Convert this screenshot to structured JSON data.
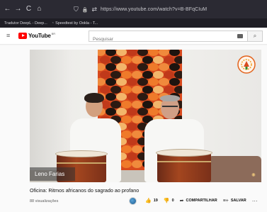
{
  "browser": {
    "nav": {
      "back_icon": "←",
      "forward_icon": "→",
      "reload_icon": "C",
      "home_icon": "⌂"
    },
    "url_bar": {
      "shield_icon": "⛉",
      "lock_icon": "🔒",
      "permissions_icon": "⇄",
      "url": "https://www.youtube.com/watch?v=B-BFqCIuM"
    },
    "bookmarks": [
      {
        "label": "Tradutor DeepL - Deep..."
      },
      {
        "label": "Speedtest by Ookla - T..."
      }
    ]
  },
  "youtube": {
    "logo_text": "YouTube",
    "logo_country": "BR",
    "search_placeholder": "Pesquisar",
    "search_icon": "⌕"
  },
  "video": {
    "presenter_name": "Leno Farias",
    "title": "Oficina: Ritmos africanos do sagrado ao profano",
    "views": "88 visualizações",
    "likes": "19",
    "dislikes": "0",
    "share_label": "COMPARTILHAR",
    "save_label": "SALVAR",
    "more_icon": "···",
    "colors": {
      "tapestry": "#d84a1e",
      "shirts": "#f7f7f5",
      "drums": "#a4461f"
    }
  }
}
